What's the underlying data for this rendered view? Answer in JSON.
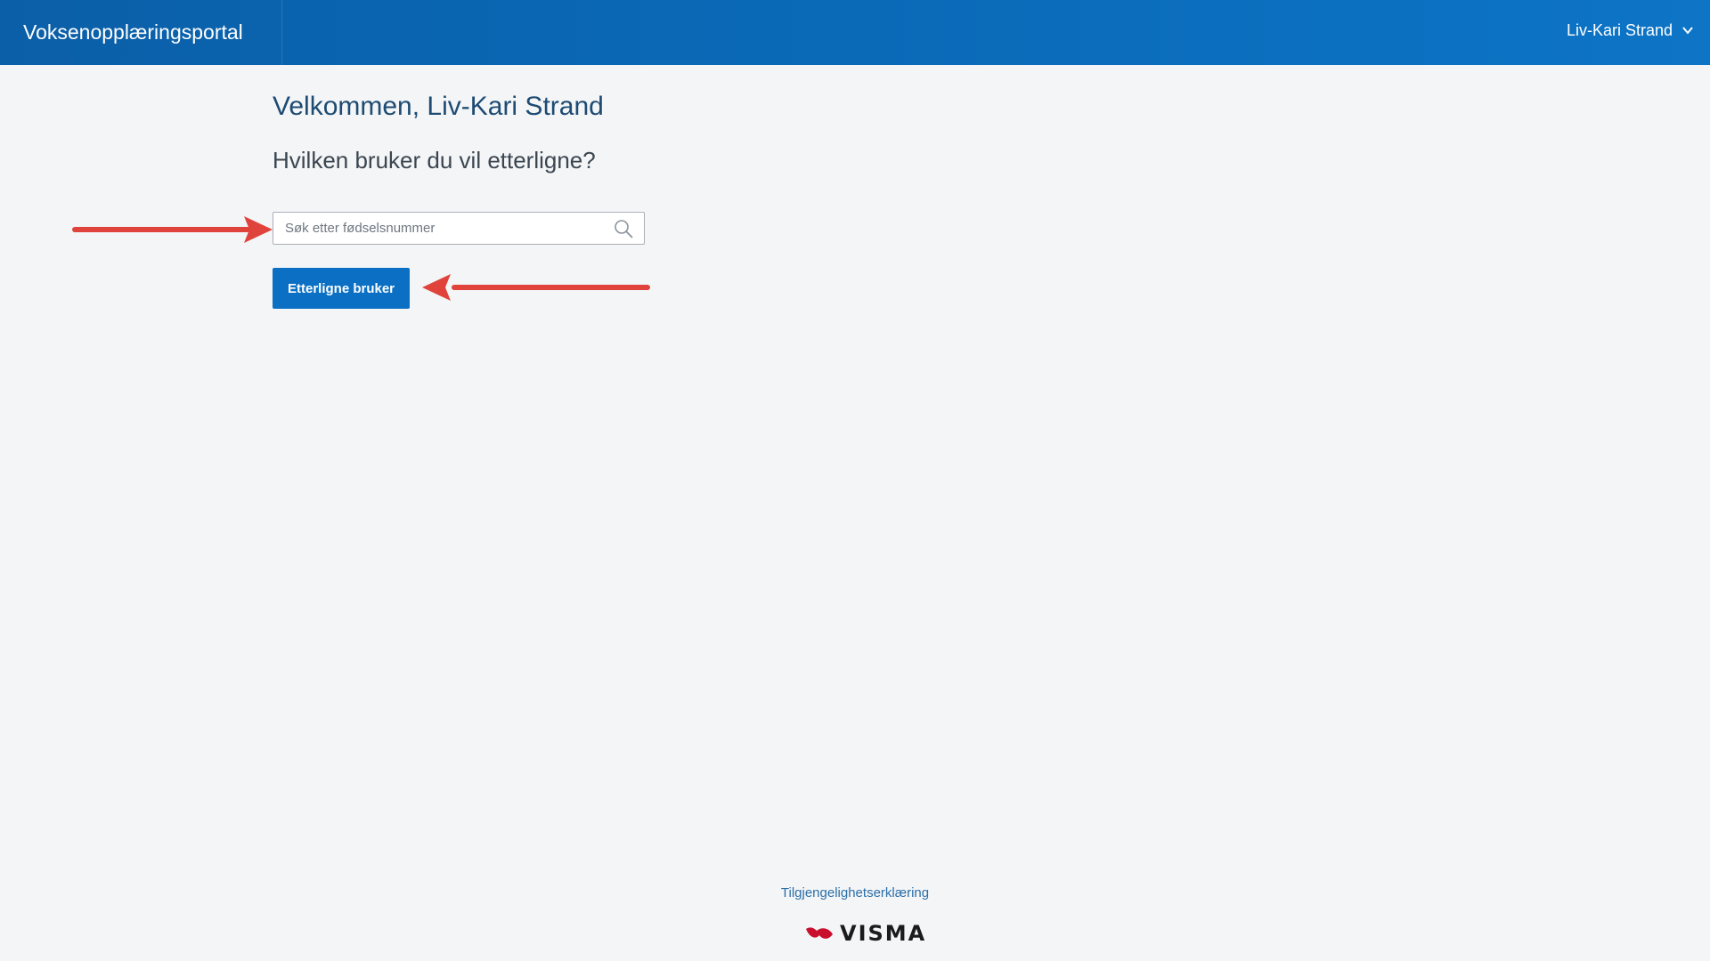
{
  "header": {
    "app_title": "Voksenopplæringsportal",
    "user_name": "Liv-Kari Strand",
    "user_menu_icon": "chevron-down-icon"
  },
  "main": {
    "welcome": "Velkommen, Liv-Kari Strand",
    "question": "Hvilken bruker du vil etterligne?",
    "search": {
      "placeholder": "Søk etter fødselsnummer",
      "value": "",
      "icon": "search-icon"
    },
    "impersonate_button": "Etterligne bruker"
  },
  "footer": {
    "accessibility_link": "Tilgjengelighetserklæring",
    "logo_text": "VISMA"
  },
  "colors": {
    "header_blue": "#0b5fa8",
    "button_blue": "#0b70c4",
    "annotation_red": "#e0433b",
    "logo_red": "#c8102e"
  }
}
